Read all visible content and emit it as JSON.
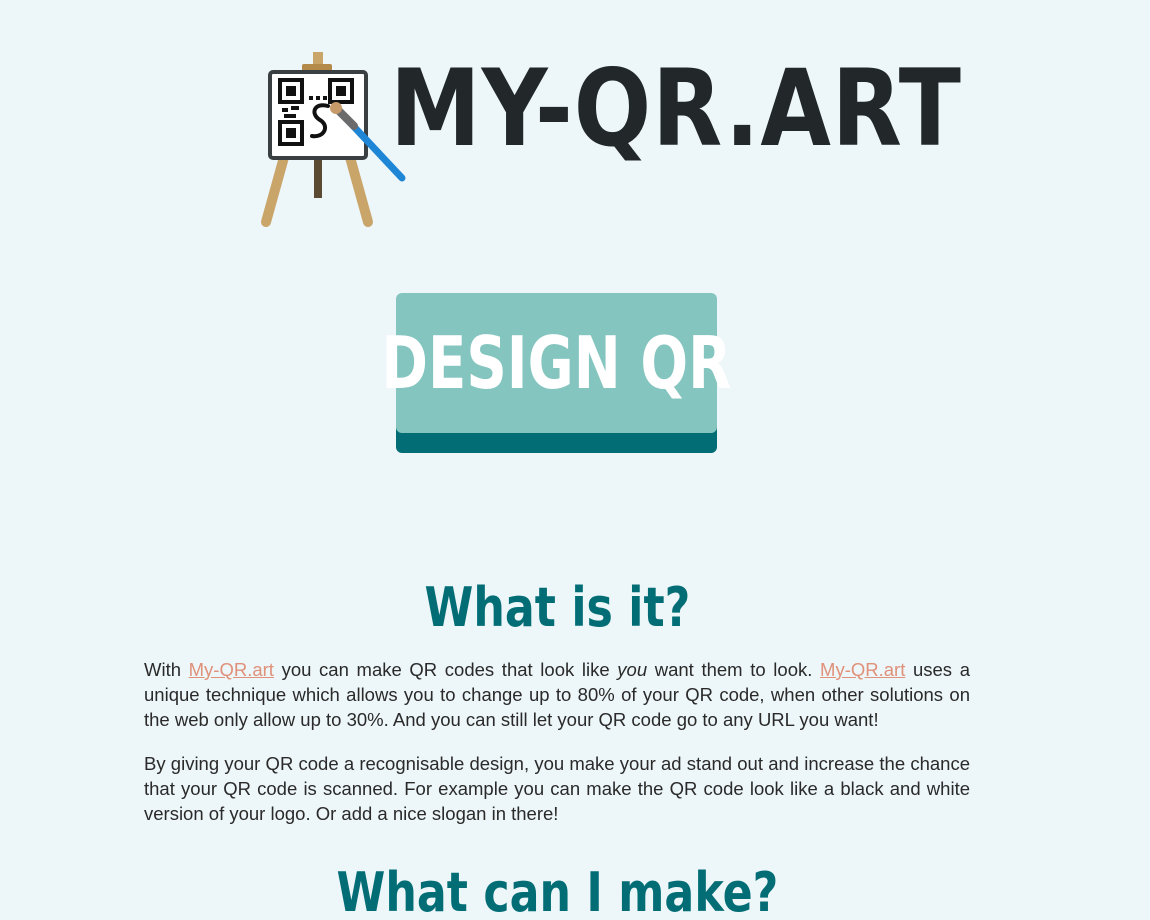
{
  "logo": {
    "text": "MY-QR.ART",
    "icon": "easel-qr-icon"
  },
  "design_button": {
    "label": "DESIGN QR"
  },
  "section_what": {
    "heading": "What is it?",
    "para1": {
      "t1": "With ",
      "link1": "My-QR.art",
      "t2": " you can make QR codes that look like ",
      "em": "you",
      "t3": " want them to look. ",
      "link2": "My-QR.art",
      "t4": " uses a unique technique which allows you to change up to 80% of your QR code, when other solutions on the web only allow up to 30%. And you can still let your QR code go to any URL you want!"
    },
    "para2": "By giving your QR code a recognisable design, you make your ad stand out and increase the chance that your QR code is scanned. For example you can make the QR code look like a black and white version of your logo. Or add a nice slogan in there!"
  },
  "section_make": {
    "heading": "What can I make?"
  },
  "colors": {
    "background": "#edf6f8",
    "accent": "#036d76",
    "button_face": "#85c5bf",
    "link": "#e0917a",
    "logo_text": "#22272a"
  }
}
